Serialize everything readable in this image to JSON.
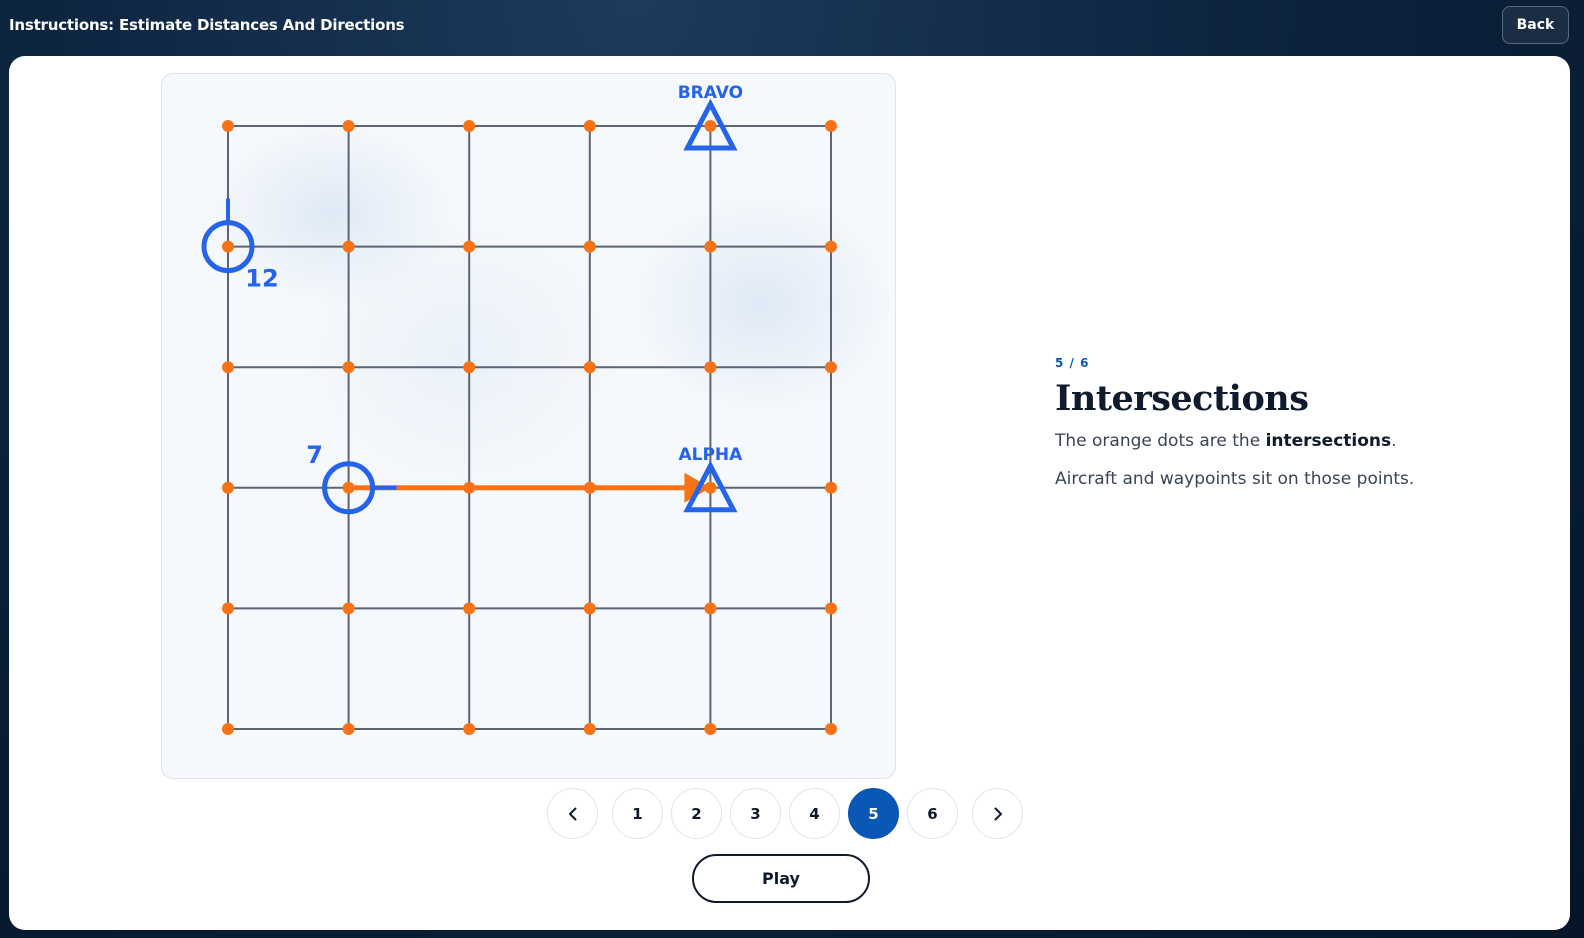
{
  "window": {
    "title": "Instructions: Estimate Distances And Directions",
    "back_label": "Back"
  },
  "board": {
    "grid": {
      "columns": 6,
      "rows": 6
    },
    "colors": {
      "grid_line": "#5b6573",
      "intersection": "#f97316",
      "aircraft": "#2563eb",
      "waypoint": "#2563eb",
      "heading_arrow": "#f97316"
    },
    "waypoints": [
      {
        "name": "BRAVO",
        "col": 4,
        "row": 0
      },
      {
        "name": "ALPHA",
        "col": 4,
        "row": 3
      }
    ],
    "aircraft": [
      {
        "label": "12",
        "col": 0,
        "row": 1,
        "heading": "north",
        "icon": "aircraft-circle-icon"
      },
      {
        "label": "7",
        "col": 1,
        "row": 3,
        "heading": "east",
        "icon": "aircraft-circle-icon"
      }
    ],
    "route": {
      "from_col": 1,
      "from_row": 3,
      "to_col": 4,
      "to_row": 3
    }
  },
  "tutorial": {
    "counter": "5 / 6",
    "title": "Intersections",
    "line1_prefix": "The orange dots are the ",
    "line1_bold": "intersections",
    "line1_suffix": ".",
    "line2": "Aircraft and waypoints sit on those points."
  },
  "pager": {
    "prev_icon": "chevron-left-icon",
    "next_icon": "chevron-right-icon",
    "pages": [
      "1",
      "2",
      "3",
      "4",
      "5",
      "6"
    ],
    "current": "5"
  },
  "play_label": "Play"
}
